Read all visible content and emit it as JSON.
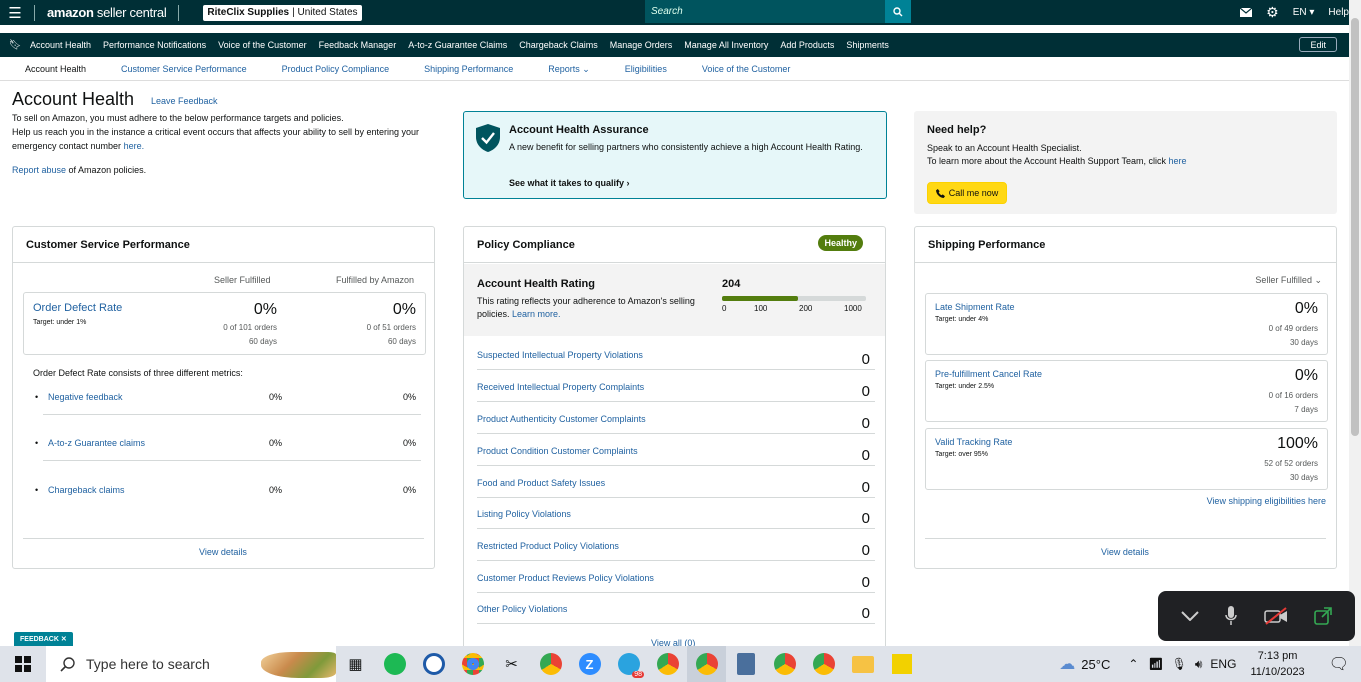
{
  "header": {
    "logo_main": "amazon",
    "logo_sub": " seller central",
    "store_name": "RiteClix Supplies",
    "store_region": "| United States",
    "search_placeholder": "Search",
    "language": "EN",
    "help": "Help"
  },
  "nav": {
    "items": [
      "Account Health",
      "Performance Notifications",
      "Voice of the Customer",
      "Feedback Manager",
      "A-to-z Guarantee Claims",
      "Chargeback Claims",
      "Manage Orders",
      "Manage All Inventory",
      "Add Products",
      "Shipments"
    ],
    "edit": "Edit"
  },
  "subnav": {
    "items": [
      "Account Health",
      "Customer Service Performance",
      "Product Policy Compliance",
      "Shipping Performance",
      "Reports",
      "Eligibilities",
      "Voice of the Customer"
    ],
    "reports_caret": "⌄"
  },
  "page": {
    "title": "Account Health",
    "leave_feedback": "Leave Feedback",
    "intro1": "To sell on Amazon, you must adhere to the below performance targets and policies.",
    "intro2": "Help us reach you in the instance a critical event occurs that affects your ability to sell by entering your emergency contact number ",
    "intro_link": "here.",
    "report_link": "Report abuse",
    "report_text": " of Amazon policies."
  },
  "assurance": {
    "title": "Account Health Assurance",
    "text": "A new benefit for selling partners who consistently achieve a high Account Health Rating.",
    "link": "See what it takes to qualify"
  },
  "help": {
    "title": "Need help?",
    "line1": "Speak to an Account Health Specialist.",
    "line2": "To learn more about the Account Health Support Team, click ",
    "line2_link": "here",
    "call": "Call me now"
  },
  "csp": {
    "title": "Customer Service Performance",
    "col1": "Seller Fulfilled",
    "col2": "Fulfilled by Amazon",
    "odr_title": "Order Defect Rate",
    "odr_target": "Target: under 1%",
    "sf_pct": "0%",
    "sf_orders": "0 of 101 orders",
    "sf_days": "60 days",
    "fba_pct": "0%",
    "fba_orders": "0 of 51 orders",
    "fba_days": "60 days",
    "metrics_intro": "Order Defect Rate consists of three different metrics:",
    "metrics": [
      {
        "name": "Negative feedback",
        "sf": "0%",
        "fba": "0%"
      },
      {
        "name": "A-to-z Guarantee claims",
        "sf": "0%",
        "fba": "0%"
      },
      {
        "name": "Chargeback claims",
        "sf": "0%",
        "fba": "0%"
      }
    ],
    "view_details": "View details"
  },
  "policy": {
    "title": "Policy Compliance",
    "status": "Healthy",
    "ahr_title": "Account Health Rating",
    "ahr_text": "This rating reflects your adherence to Amazon's selling policies. ",
    "ahr_link": "Learn more.",
    "score": "204",
    "score_fraction": 0.53,
    "ticks": [
      "0",
      "100",
      "200",
      "1000"
    ],
    "rows": [
      {
        "name": "Suspected Intellectual Property Violations",
        "value": "0"
      },
      {
        "name": "Received Intellectual Property Complaints",
        "value": "0"
      },
      {
        "name": "Product Authenticity Customer Complaints",
        "value": "0"
      },
      {
        "name": "Product Condition Customer Complaints",
        "value": "0"
      },
      {
        "name": "Food and Product Safety Issues",
        "value": "0"
      },
      {
        "name": "Listing Policy Violations",
        "value": "0"
      },
      {
        "name": "Restricted Product Policy Violations",
        "value": "0"
      },
      {
        "name": "Customer Product Reviews Policy Violations",
        "value": "0"
      },
      {
        "name": "Other Policy Violations",
        "value": "0"
      }
    ],
    "view_all": "View all (0)"
  },
  "shipping": {
    "title": "Shipping Performance",
    "selector": "Seller Fulfilled ⌄",
    "boxes": [
      {
        "name": "Late Shipment Rate",
        "target": "Target: under 4%",
        "pct": "0%",
        "orders": "0 of 49 orders",
        "days": "30 days"
      },
      {
        "name": "Pre-fulfillment Cancel Rate",
        "target": "Target: under 2.5%",
        "pct": "0%",
        "orders": "0 of 16 orders",
        "days": "7 days"
      },
      {
        "name": "Valid Tracking Rate",
        "target": "Target: over 95%",
        "pct": "100%",
        "orders": "52 of 52 orders",
        "days": "30 days"
      }
    ],
    "eligibilities_link": "View shipping eligibilities here",
    "view_details": "View details"
  },
  "feedback_tab": "FEEDBACK ✕",
  "taskbar": {
    "search": "Type here to search",
    "weather": "25°C",
    "lang": "ENG",
    "time": "7:13 pm",
    "date": "11/10/2023",
    "badge": "98"
  },
  "colors": {
    "header": "#002f36",
    "link": "#2162a1",
    "healthy": "#537d0e",
    "accent": "#008296",
    "call_btn": "#ffd814"
  }
}
